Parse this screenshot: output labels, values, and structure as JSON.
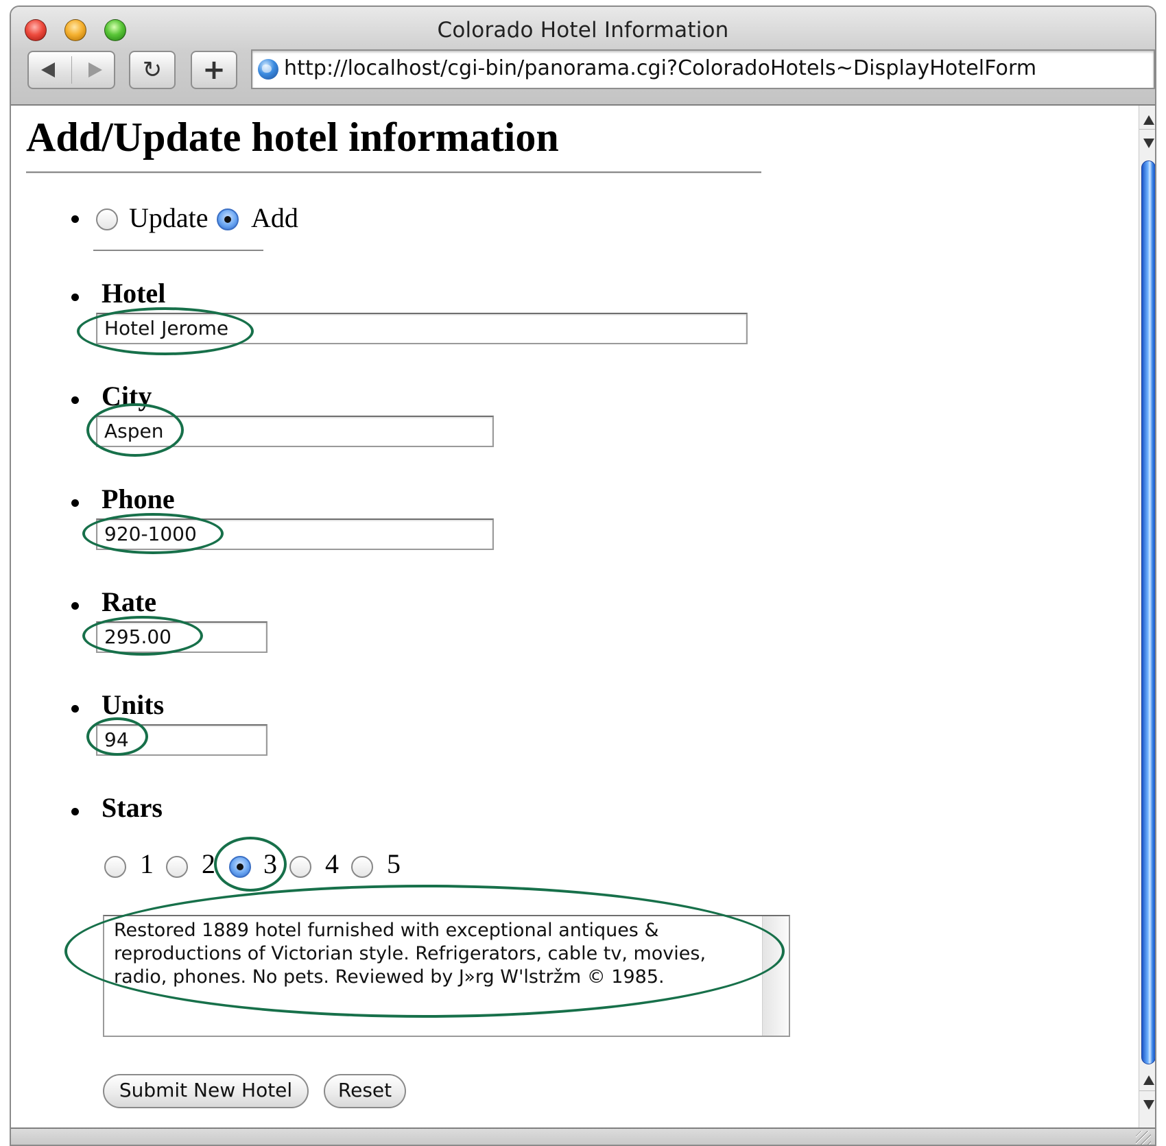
{
  "window": {
    "title": "Colorado Hotel Information",
    "url": "http://localhost/cgi-bin/panorama.cgi?ColoradoHotels~DisplayHotelForm"
  },
  "page": {
    "title": "Add/Update hotel information"
  },
  "mode": {
    "options": [
      {
        "label": "Update",
        "selected": false
      },
      {
        "label": "Add",
        "selected": true
      }
    ]
  },
  "form": {
    "hotel": {
      "label": "Hotel",
      "value": "Hotel Jerome"
    },
    "city": {
      "label": "City",
      "value": "Aspen"
    },
    "phone": {
      "label": "Phone",
      "value": "920-1000"
    },
    "rate": {
      "label": "Rate",
      "value": "295.00"
    },
    "units": {
      "label": "Units",
      "value": "94"
    },
    "stars": {
      "label": "Stars",
      "options": [
        "1",
        "2",
        "3",
        "4",
        "5"
      ],
      "selected": "3"
    },
    "description": "Restored 1889 hotel furnished with exceptional antiques & reproductions of Victorian style. Refrigerators, cable tv, movies, radio, phones. No pets. Reviewed by J»rg W'lstržm © 1985.",
    "submit_label": "Submit New Hotel",
    "reset_label": "Reset"
  },
  "icons": {
    "back": "back-arrow-icon",
    "forward": "forward-arrow-icon",
    "reload": "reload-icon",
    "add_bookmark": "plus-icon",
    "site": "globe-icon"
  },
  "colors": {
    "annotation_ring": "#17704a",
    "radio_selected": "#2e67c8",
    "scroll_thumb": "#3c86e8"
  }
}
